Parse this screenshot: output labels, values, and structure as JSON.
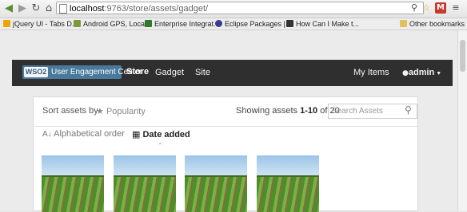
{
  "browser": {
    "url_host": "localhost",
    "url_path": ":9763/store/assets/gadget/",
    "bookmarks": [
      {
        "label": "jQuery UI - Tabs D...",
        "color": "#f0a400"
      },
      {
        "label": "Android GPS, Loca...",
        "color": "#7a9a3a"
      },
      {
        "label": "Enterprise Integrat...",
        "color": "#2d7a2d"
      },
      {
        "label": "Eclipse Packages |...",
        "color": "#3b3b8f"
      },
      {
        "label": "How Can I Make t...",
        "color": "#333333"
      }
    ],
    "other_bookmarks": "Other bookmarks"
  },
  "header": {
    "logo_mark": "WSO2",
    "brand": "User Engagement Center",
    "store": "Store",
    "nav": [
      "Gadget",
      "Site"
    ],
    "my_items": "My Items",
    "user": "admin"
  },
  "toolbar": {
    "sort_label": "Sort assets by",
    "popularity": "Popularity",
    "showing_prefix": "Showing assets",
    "showing_range": "1-10",
    "showing_of": "of",
    "showing_total": "20",
    "search_placeholder": "Search Assets",
    "alphabetical": "Alphabetical order",
    "date_added": "Date added"
  },
  "colors": {
    "topbar": "#2f2f2f",
    "brand_box": "#4a7a9b"
  },
  "icons": {
    "star": "star-icon",
    "search": "search-icon",
    "sort_alpha": "sort-alpha-icon",
    "calendar": "calendar-icon",
    "user": "user-icon"
  }
}
